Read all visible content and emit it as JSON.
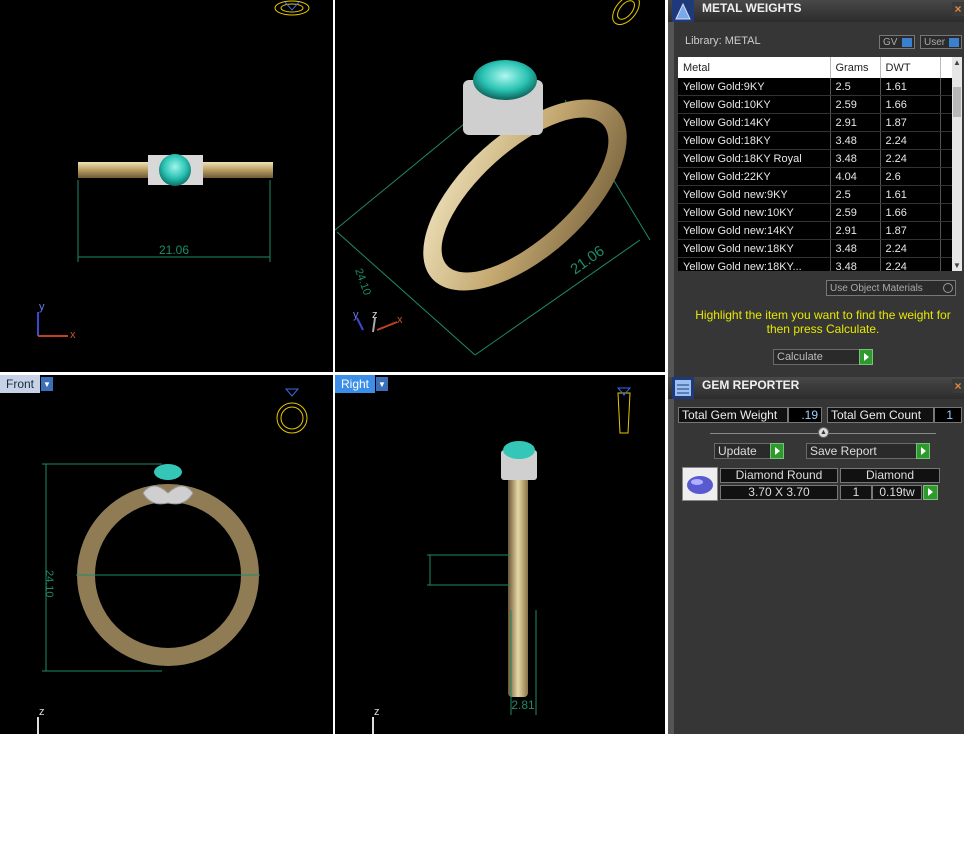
{
  "viewports": {
    "top": {
      "dim_width": "21.06",
      "axes": {
        "y": "y",
        "x": "x"
      }
    },
    "perspective": {
      "dim_width": "21.06",
      "dim_height": "24.10",
      "axes": {
        "y": "y",
        "z": "z",
        "x": "x"
      }
    },
    "front": {
      "label": "Front",
      "dim_height": "24.10",
      "axis_z": "z"
    },
    "right": {
      "label": "Right",
      "dim_depth": "2.81",
      "axis_z": "z"
    }
  },
  "metal_weights": {
    "title": "METAL WEIGHTS",
    "library_label": "Library: METAL",
    "gv_label": "GV",
    "user_label": "User",
    "columns": [
      "Metal",
      "Grams",
      "DWT"
    ],
    "rows": [
      [
        "Yellow Gold:9KY",
        "2.5",
        "1.61"
      ],
      [
        "Yellow Gold:10KY",
        "2.59",
        "1.66"
      ],
      [
        "Yellow Gold:14KY",
        "2.91",
        "1.87"
      ],
      [
        "Yellow Gold:18KY",
        "3.48",
        "2.24"
      ],
      [
        "Yellow Gold:18KY Royal",
        "3.48",
        "2.24"
      ],
      [
        "Yellow Gold:22KY",
        "4.04",
        "2.6"
      ],
      [
        "Yellow Gold new:9KY",
        "2.5",
        "1.61"
      ],
      [
        "Yellow Gold new:10KY",
        "2.59",
        "1.66"
      ],
      [
        "Yellow Gold new:14KY",
        "2.91",
        "1.87"
      ],
      [
        "Yellow Gold new:18KY",
        "3.48",
        "2.24"
      ],
      [
        "Yellow Gold new:18KY...",
        "3.48",
        "2.24"
      ]
    ],
    "use_object_materials": "Use Object Materials",
    "hint": "Highlight the item you want to find the weight for then press Calculate.",
    "calculate_label": "Calculate"
  },
  "gem_reporter": {
    "title": "GEM REPORTER",
    "total_weight_label": "Total Gem Weight",
    "total_weight_value": ".19",
    "total_count_label": "Total Gem Count",
    "total_count_value": "1",
    "update_label": "Update",
    "save_report_label": "Save Report",
    "gem": {
      "shape": "Diamond Round",
      "size": "3.70 X 3.70",
      "material": "Diamond",
      "count": "1",
      "weight": "0.19tw"
    }
  },
  "colors": {
    "viewport_bg": "#000000",
    "panel_bg": "#363636",
    "dimension_line": "#1f8a6a",
    "hint_text": "#e8e800",
    "gold": "#c9b27a",
    "gem": "#3fd0c0"
  }
}
